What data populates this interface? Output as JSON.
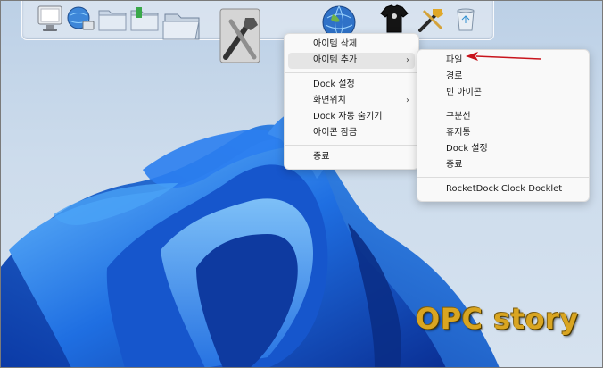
{
  "colors": {
    "bloom_dark": "#0a3aa8",
    "bloom_mid": "#1c6fe0",
    "bloom_light": "#5fb0f5",
    "arrow": "#c8141c",
    "watermark": "#d9a521"
  },
  "dock": {
    "icons": [
      "monitor-icon",
      "globe-network-icon",
      "folder-icon",
      "folder-tools-icon",
      "folder-open-icon",
      "tools-icon",
      "globe-icon",
      "tshirt-icon",
      "hammer-wrench-icon",
      "recycle-bin-icon"
    ]
  },
  "context_menu": {
    "items": [
      {
        "label": "아이템 삭제"
      },
      {
        "label": "아이템 추가",
        "has_submenu": true,
        "highlighted": true
      },
      {
        "label": "Dock 설정"
      },
      {
        "label": "화면위치",
        "has_submenu": true
      },
      {
        "label": "Dock 자동 숨기기"
      },
      {
        "label": "아이콘 잠금"
      },
      {
        "label": "종료"
      }
    ]
  },
  "submenu": {
    "items": [
      {
        "label": "파일"
      },
      {
        "label": "경로"
      },
      {
        "label": "빈 아이콘"
      },
      {
        "label": "구분선"
      },
      {
        "label": "휴지통"
      },
      {
        "label": "Dock 설정"
      },
      {
        "label": "종료"
      },
      {
        "label": "RocketDock Clock Docklet"
      }
    ]
  },
  "watermark": {
    "text": "OPC story"
  }
}
